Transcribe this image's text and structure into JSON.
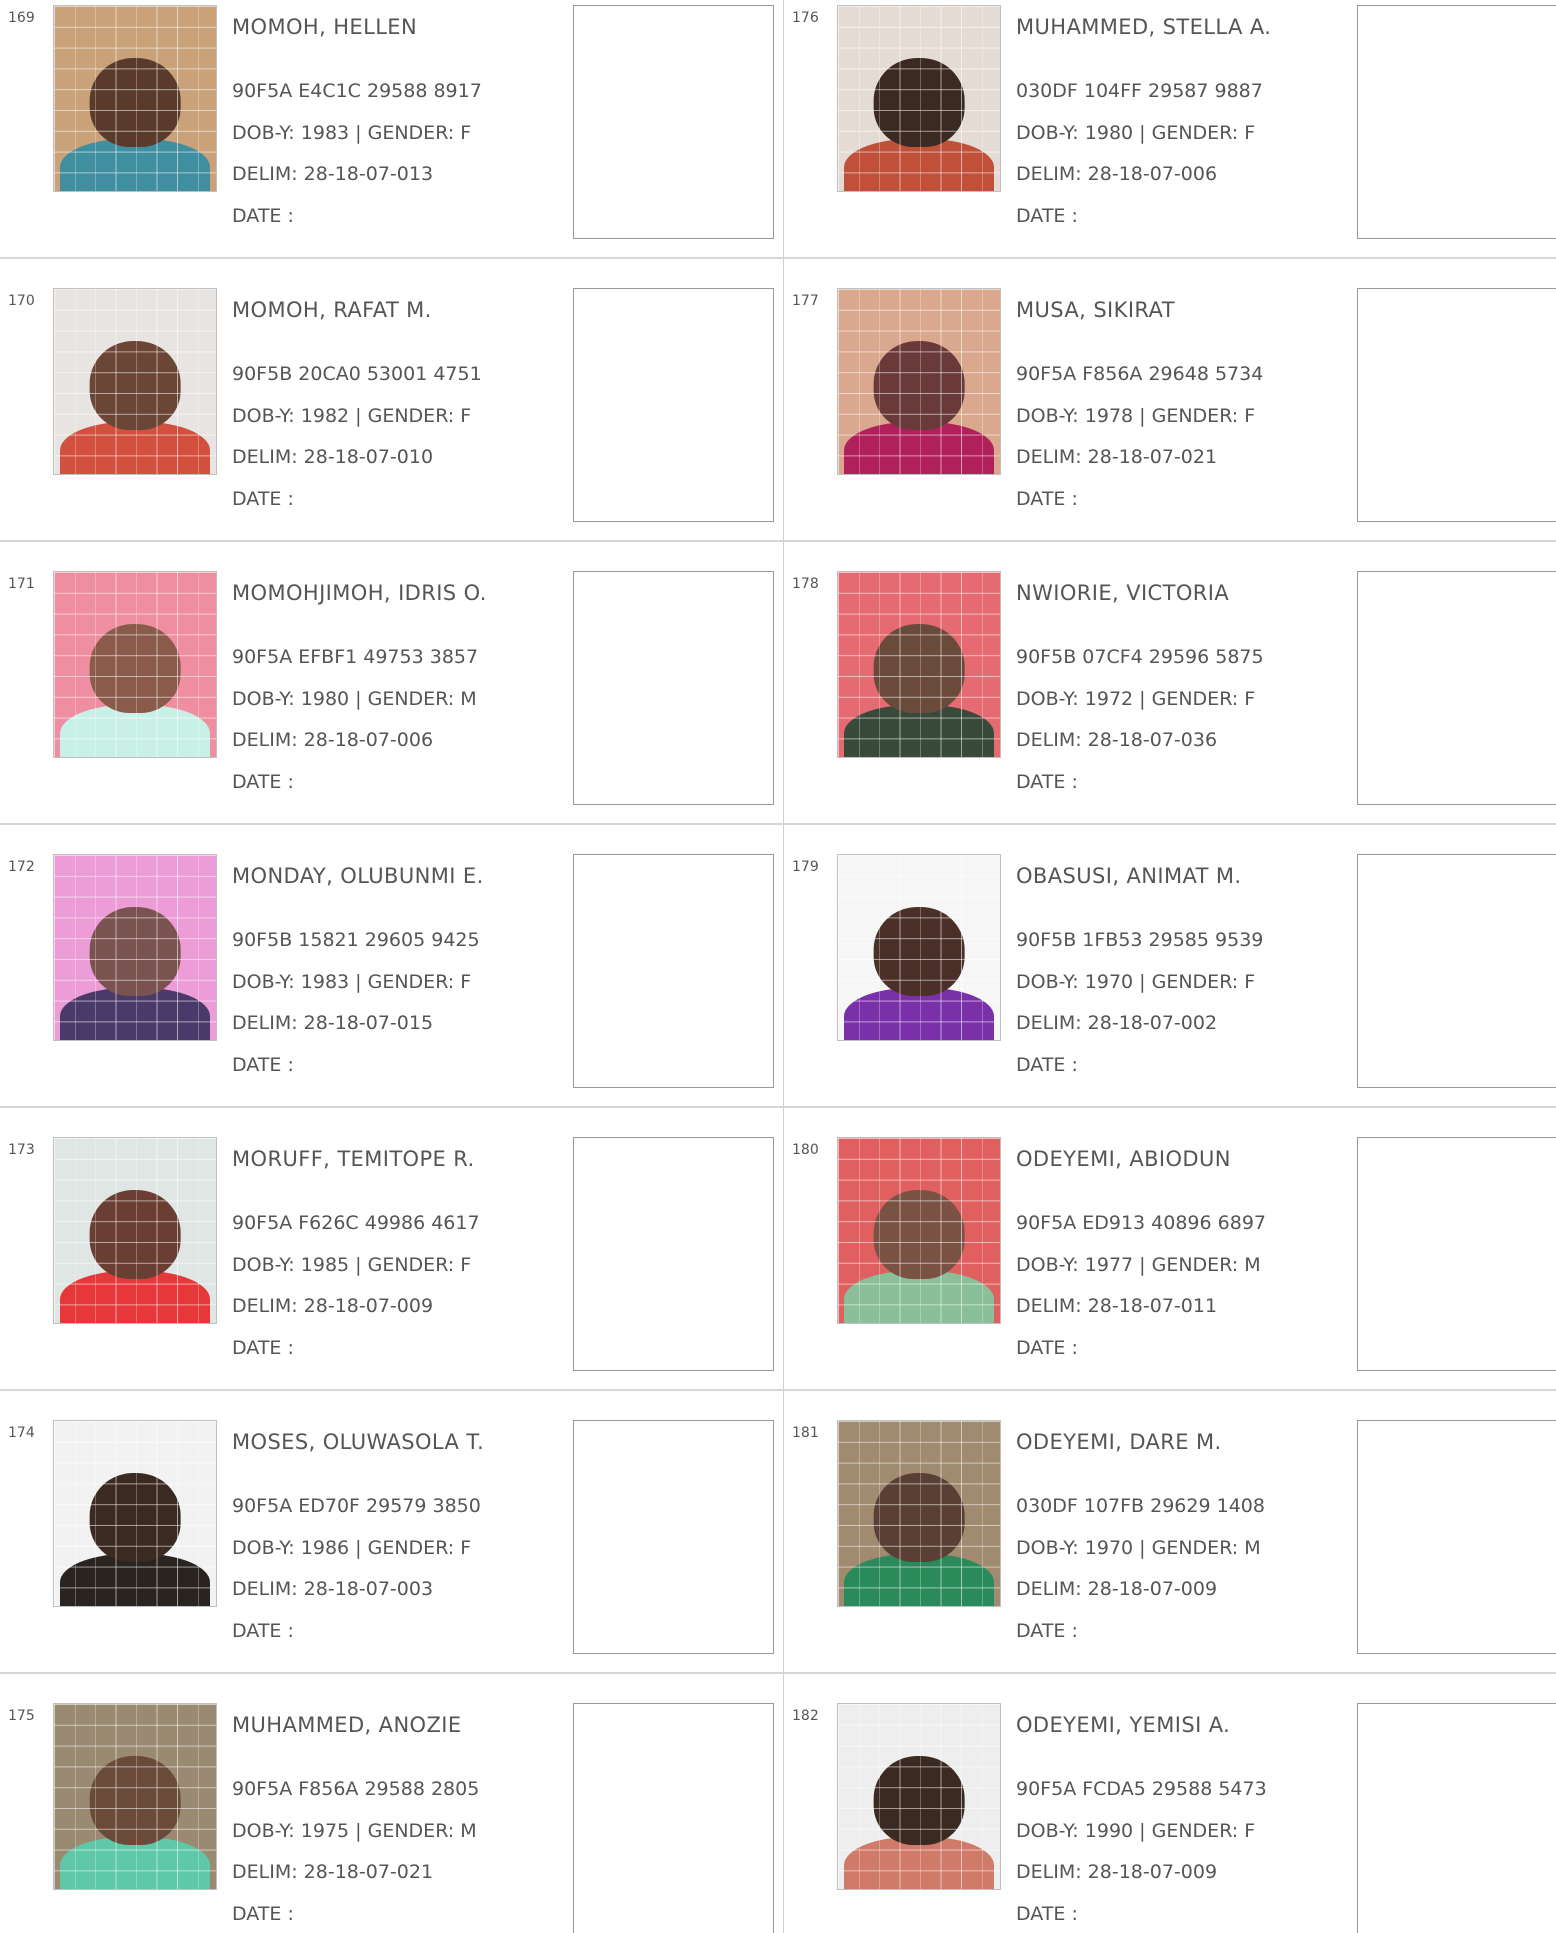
{
  "labels": {
    "dob_prefix": "DOB-Y:",
    "gender_prefix": "| GENDER:",
    "delim_prefix": "DELIM:",
    "date_label": "DATE :"
  },
  "left_column": [
    {
      "serial": "169",
      "name": "MOMOH, HELLEN",
      "vin": "90F5A E4C1C 29588 8917",
      "dob": "1983",
      "gender": "F",
      "delim": "28-18-07-013",
      "photo_bg": "#c9a27a",
      "photo_head": "#5a3a2a",
      "photo_body": "#3f8fa0"
    },
    {
      "serial": "170",
      "name": "MOMOH, RAFAT M.",
      "vin": "90F5B 20CA0 53001 4751",
      "dob": "1982",
      "gender": "F",
      "delim": "28-18-07-010",
      "photo_bg": "#e8e4e2",
      "photo_head": "#6b4636",
      "photo_body": "#d2503e"
    },
    {
      "serial": "171",
      "name": "MOMOHJIMOH, IDRIS O.",
      "vin": "90F5A EFBF1 49753 3857",
      "dob": "1980",
      "gender": "M",
      "delim": "28-18-07-006",
      "photo_bg": "#ef8ea0",
      "photo_head": "#8a5a4a",
      "photo_body": "#c9f0e6"
    },
    {
      "serial": "172",
      "name": "MONDAY, OLUBUNMI E.",
      "vin": "90F5B 15821 29605 9425",
      "dob": "1983",
      "gender": "F",
      "delim": "28-18-07-015",
      "photo_bg": "#ec9cd6",
      "photo_head": "#7a5250",
      "photo_body": "#4a3a6a"
    },
    {
      "serial": "173",
      "name": "MORUFF, TEMITOPE R.",
      "vin": "90F5A F626C 49986 4617",
      "dob": "1985",
      "gender": "F",
      "delim": "28-18-07-009",
      "photo_bg": "#dfe6e4",
      "photo_head": "#6a3e32",
      "photo_body": "#e6383a"
    },
    {
      "serial": "174",
      "name": "MOSES, OLUWASOLA T.",
      "vin": "90F5A ED70F 29579 3850",
      "dob": "1986",
      "gender": "F",
      "delim": "28-18-07-003",
      "photo_bg": "#f2f2f2",
      "photo_head": "#3a2a22",
      "photo_body": "#2a2420"
    },
    {
      "serial": "175",
      "name": "MUHAMMED, ANOZIE",
      "vin": "90F5A F856A 29588 2805",
      "dob": "1975",
      "gender": "M",
      "delim": "28-18-07-021",
      "photo_bg": "#9a8a72",
      "photo_head": "#6a4a38",
      "photo_body": "#5ec8a8"
    }
  ],
  "right_column": [
    {
      "serial": "176",
      "name": "MUHAMMED, STELLA A.",
      "vin": "030DF 104FF 29587 9887",
      "dob": "1980",
      "gender": "F",
      "delim": "28-18-07-006",
      "photo_bg": "#e4dcd4",
      "photo_head": "#3a2a22",
      "photo_body": "#c0503a"
    },
    {
      "serial": "177",
      "name": "MUSA, SIKIRAT",
      "vin": "90F5A F856A 29648 5734",
      "dob": "1978",
      "gender": "F",
      "delim": "28-18-07-021",
      "photo_bg": "#d9a88e",
      "photo_head": "#6a3a3a",
      "photo_body": "#b0205a"
    },
    {
      "serial": "178",
      "name": "NWIORIE, VICTORIA",
      "vin": "90F5B 07CF4 29596 5875",
      "dob": "1972",
      "gender": "F",
      "delim": "28-18-07-036",
      "photo_bg": "#e66a72",
      "photo_head": "#6a4a3a",
      "photo_body": "#3a4a3a"
    },
    {
      "serial": "179",
      "name": "OBASUSI, ANIMAT M.",
      "vin": "90F5B 1FB53 29585 9539",
      "dob": "1970",
      "gender": "F",
      "delim": "28-18-07-002",
      "photo_bg": "#f6f6f6",
      "photo_head": "#4a3028",
      "photo_body": "#7a30a8"
    },
    {
      "serial": "180",
      "name": "ODEYEMI, ABIODUN",
      "vin": "90F5A ED913 40896 6897",
      "dob": "1977",
      "gender": "M",
      "delim": "28-18-07-011",
      "photo_bg": "#e06060",
      "photo_head": "#7a5244",
      "photo_body": "#8abf9a"
    },
    {
      "serial": "181",
      "name": "ODEYEMI, DARE M.",
      "vin": "030DF 107FB 29629 1408",
      "dob": "1970",
      "gender": "M",
      "delim": "28-18-07-009",
      "photo_bg": "#a08a70",
      "photo_head": "#5a4034",
      "photo_body": "#2a8a5a"
    },
    {
      "serial": "182",
      "name": "ODEYEMI, YEMISI A.",
      "vin": "90F5A FCDA5 29588 5473",
      "dob": "1990",
      "gender": "F",
      "delim": "28-18-07-009",
      "photo_bg": "#eeeeee",
      "photo_head": "#3a2a22",
      "photo_body": "#d07a6a"
    }
  ]
}
